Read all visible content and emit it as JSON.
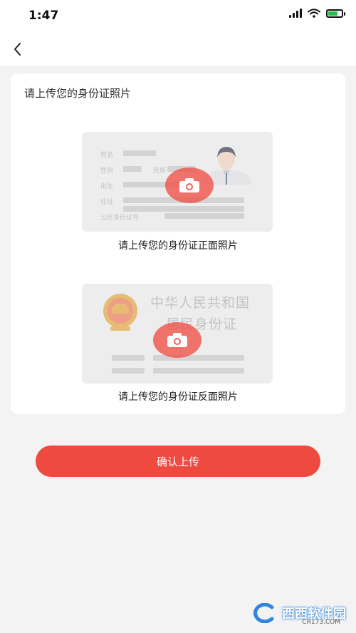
{
  "status_bar": {
    "time": "1:47"
  },
  "page": {
    "card_title": "请上传您的身份证照片",
    "front": {
      "caption": "请上传您的身份证正面照片",
      "field_labels": [
        "姓名",
        "性别",
        "民族",
        "出生",
        "住址",
        "公民身份证号"
      ]
    },
    "back": {
      "caption": "请上传您的身份证反面照片",
      "title_line1": "中华人民共和国",
      "title_line2": "居民身份证"
    },
    "confirm_label": "确认上传"
  },
  "watermark": {
    "text": "西西软件园",
    "sub": "CR173.COM"
  },
  "colors": {
    "accent": "#ef4a40",
    "background": "#f3f3f4",
    "card": "#ffffff"
  },
  "icons": [
    "back-chevron-icon",
    "camera-icon",
    "signal-icon",
    "wifi-icon",
    "battery-icon",
    "portrait-icon",
    "national-emblem-icon"
  ]
}
